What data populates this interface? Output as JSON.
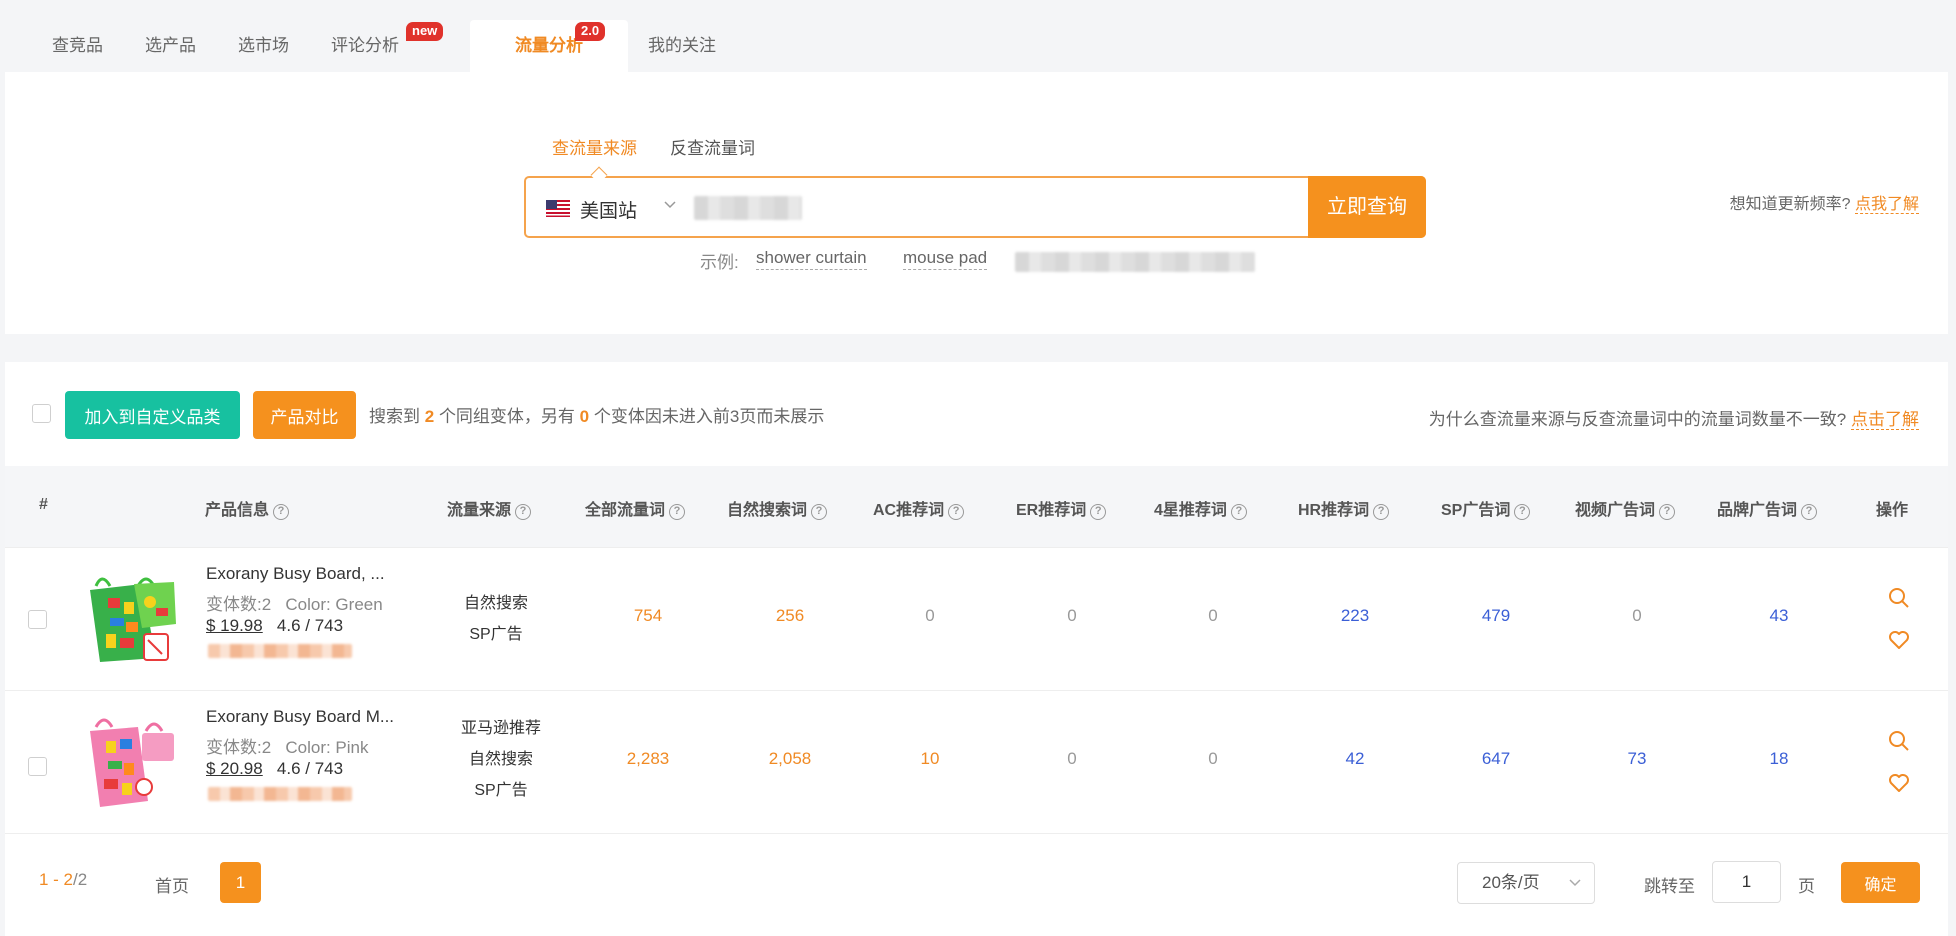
{
  "tabs": [
    {
      "label": "查竞品"
    },
    {
      "label": "选产品"
    },
    {
      "label": "选市场"
    },
    {
      "label": "评论分析",
      "badge": "new"
    },
    {
      "label": "流量分析",
      "badge": "2.0",
      "active": true
    },
    {
      "label": "我的关注"
    }
  ],
  "search": {
    "tab_source": "查流量来源",
    "tab_reverse": "反查流量词",
    "site": "美国站",
    "button": "立即查询",
    "examples_label": "示例:",
    "examples": [
      "shower curtain",
      "mouse pad"
    ],
    "freq_question": "想知道更新频率?",
    "freq_link": "点我了解"
  },
  "toolbar": {
    "add_custom": "加入到自定义品类",
    "compare": "产品对比",
    "summary_a": "搜索到",
    "summary_count": "2",
    "summary_b": "个同组变体，另有",
    "summary_hidden": "0",
    "summary_c": "个变体因未进入前3页而未展示",
    "why_question": "为什么查流量来源与反查流量词中的流量词数量不一致?",
    "why_link": "点击了解"
  },
  "table": {
    "headers": [
      "#",
      "产品信息",
      "流量来源",
      "全部流量词",
      "自然搜索词",
      "AC推荐词",
      "ER推荐词",
      "4星推荐词",
      "HR推荐词",
      "SP广告词",
      "视频广告词",
      "品牌广告词",
      "操作"
    ],
    "rows": [
      {
        "name": "Exorany Busy Board, ...",
        "variants": "变体数:2",
        "color": "Color: Green",
        "price": "$ 19.98",
        "rating": "4.6 / 743",
        "sources": [
          "自然搜索",
          "SP广告"
        ],
        "all": "754",
        "organic": "256",
        "ac": "0",
        "er": "0",
        "star4": "0",
        "hr": "223",
        "sp": "479",
        "video": "0",
        "brand": "43"
      },
      {
        "name": "Exorany Busy Board M...",
        "variants": "变体数:2",
        "color": "Color: Pink",
        "price": "$ 20.98",
        "rating": "4.6 / 743",
        "sources": [
          "亚马逊推荐",
          "自然搜索",
          "SP广告"
        ],
        "all": "2,283",
        "organic": "2,058",
        "ac": "10",
        "er": "0",
        "star4": "0",
        "hr": "42",
        "sp": "647",
        "video": "73",
        "brand": "18"
      }
    ]
  },
  "pager": {
    "range": "1 - 2",
    "total": "/2",
    "first": "首页",
    "current": "1",
    "page_size": "20条/页",
    "jump_label": "跳转至",
    "jump_value": "1",
    "page_unit": "页",
    "confirm": "确定"
  },
  "colors": {
    "accent": "#f5911e",
    "teal": "#17c1a0",
    "blue_number": "#3b5fd6",
    "badge_red": "#e0322b"
  }
}
